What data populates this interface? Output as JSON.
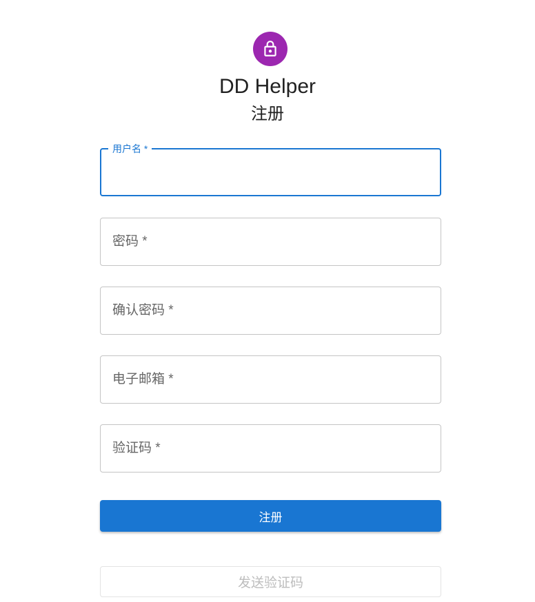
{
  "app": {
    "title": "DD Helper",
    "subtitle": "注册"
  },
  "avatar": {
    "icon": "lock-icon",
    "color": "#9c27b0"
  },
  "form": {
    "fields": [
      {
        "label": "用户名 *",
        "value": "",
        "focused": true
      },
      {
        "label": "密码 *",
        "value": ""
      },
      {
        "label": "确认密码 *",
        "value": ""
      },
      {
        "label": "电子邮箱 *",
        "value": ""
      },
      {
        "label": "验证码 *",
        "value": ""
      }
    ],
    "submit_label": "注册",
    "send_code_label": "发送验证码",
    "send_code_disabled": true
  },
  "colors": {
    "primary": "#1976d2",
    "avatar": "#9c27b0",
    "border": "#c4c4c4",
    "disabled_text": "#bdbdbd"
  }
}
